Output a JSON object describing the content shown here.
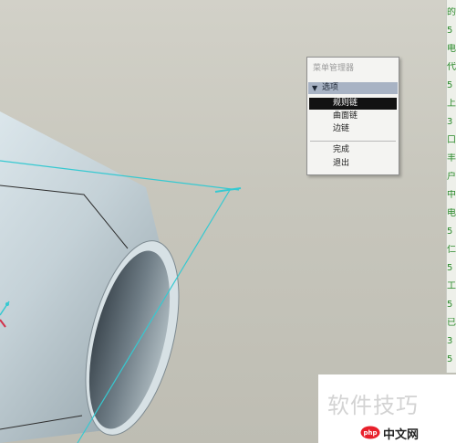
{
  "menu": {
    "title": "菜单管理器",
    "section": "选项",
    "items": [
      {
        "label": "规则链",
        "selected": true
      },
      {
        "label": "曲面链",
        "selected": false
      },
      {
        "label": "边链",
        "selected": false
      }
    ],
    "actions": [
      {
        "label": "完成"
      },
      {
        "label": "退出"
      }
    ]
  },
  "right_strip": {
    "glyphs": [
      "的",
      "5",
      "电",
      "代",
      "5",
      "上",
      "3",
      "口",
      "丰",
      "户",
      "中",
      "电",
      "5",
      "仁",
      "5",
      "工",
      "5",
      "已",
      "3",
      "5"
    ]
  },
  "watermark": {
    "text": "软件技巧",
    "logo_label": "php",
    "site": "中文网"
  },
  "colors": {
    "viewport_bg": "#c7c6bc",
    "cylinder_body": "#c9d6dc",
    "cylinder_inner": "#5a6770",
    "axis_line": "#36c9d1",
    "menu_highlight": "#121212",
    "menu_section_bg": "#a8b3c4"
  }
}
